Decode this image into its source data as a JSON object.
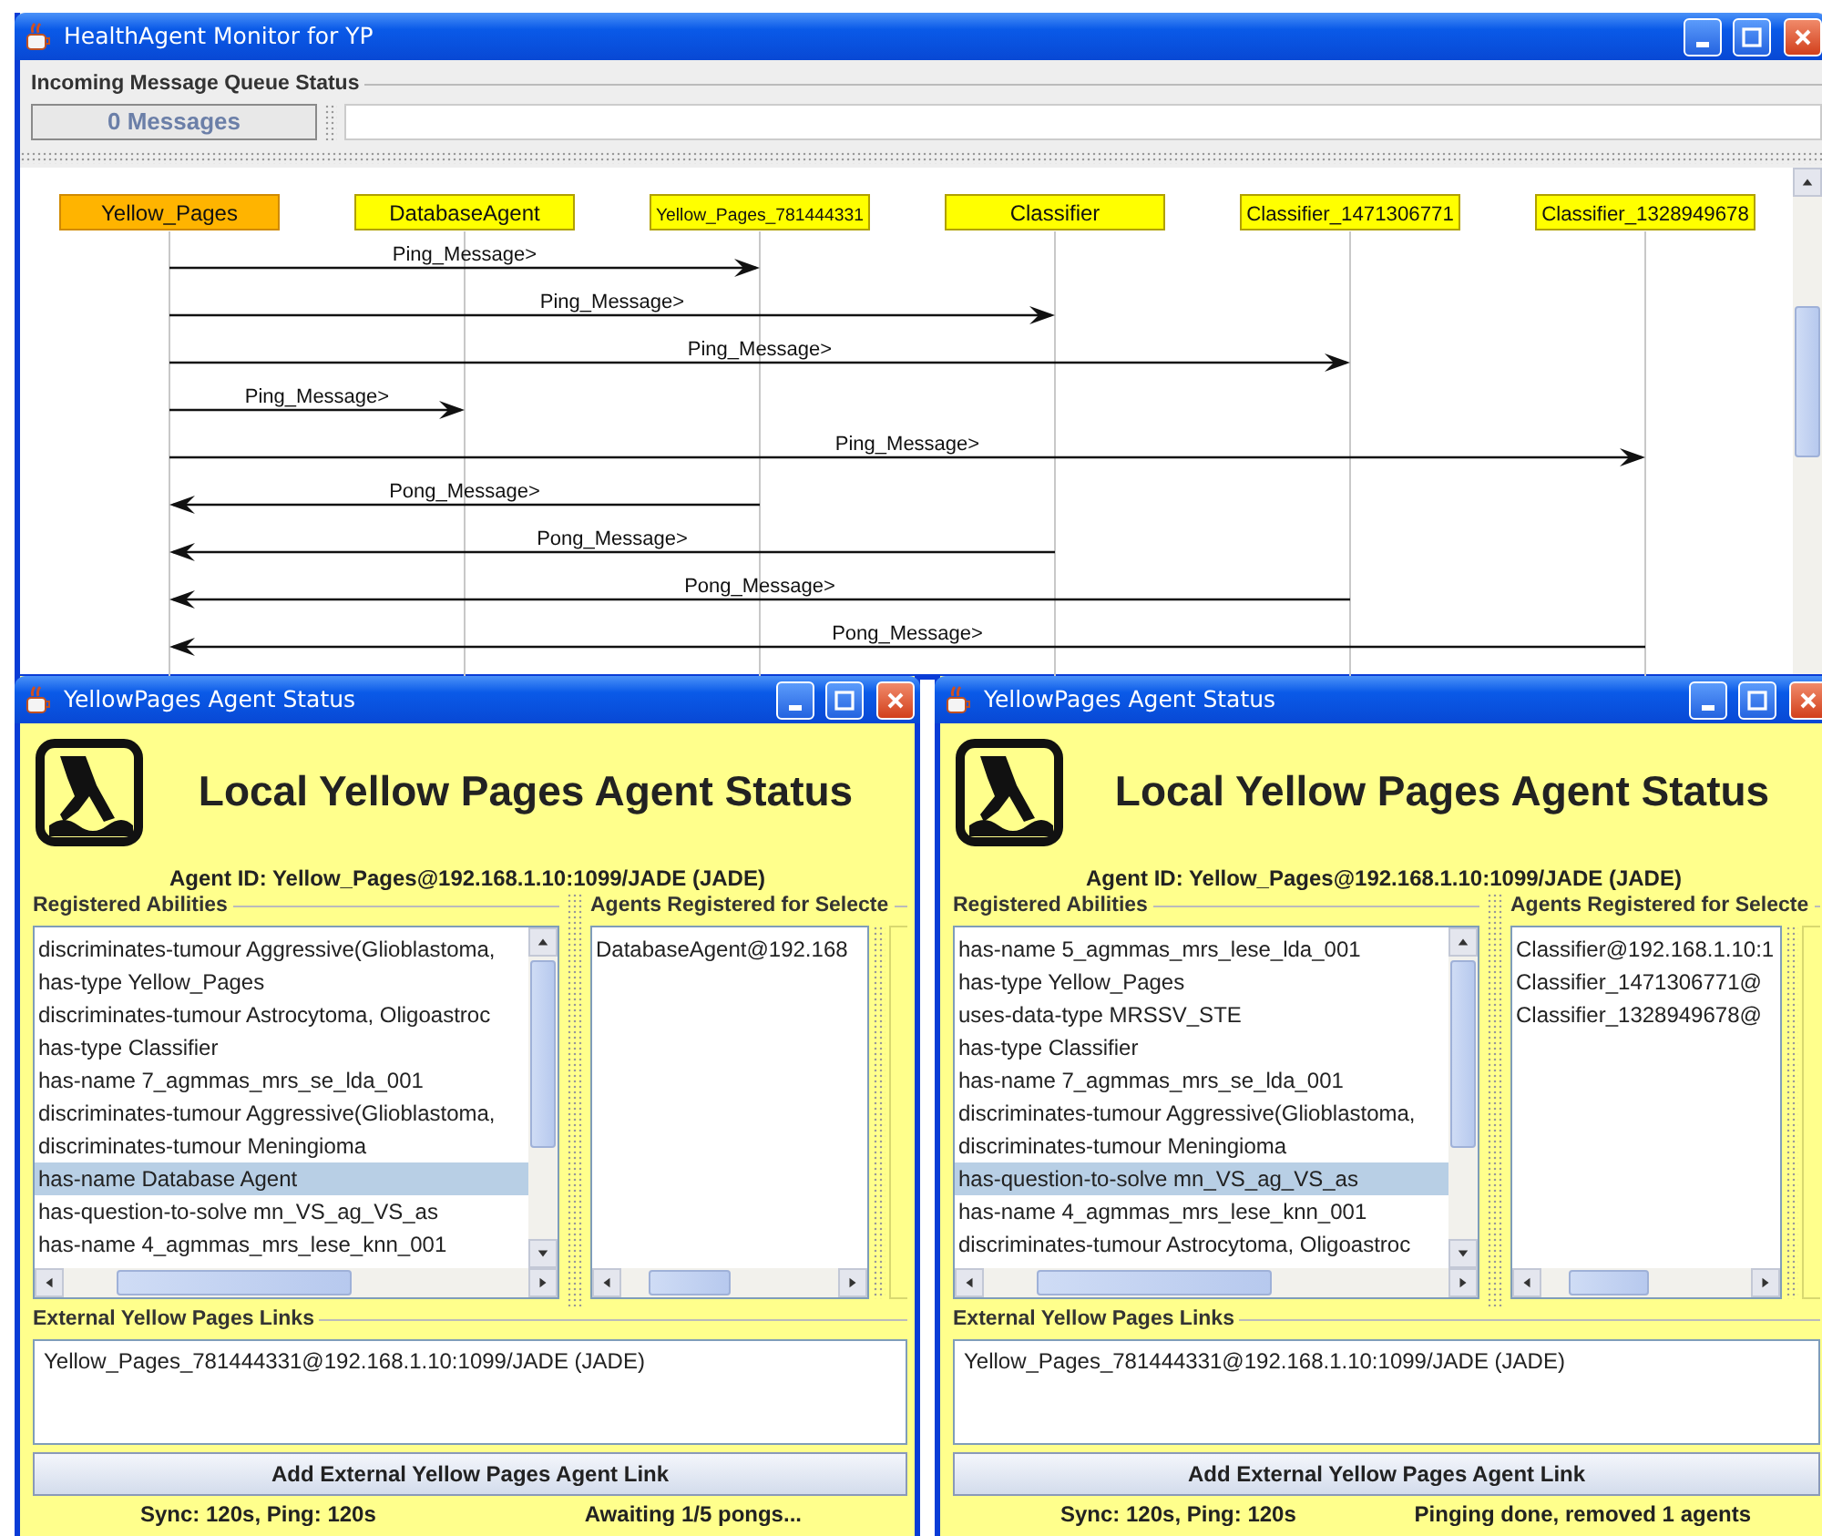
{
  "main_window": {
    "title": "HealthAgent Monitor for YP",
    "queue_group": "Incoming Message Queue Status",
    "message_count": "0 Messages",
    "sequence_diagram": {
      "agents": [
        {
          "name": "Yellow_Pages",
          "selected": true
        },
        {
          "name": "DatabaseAgent",
          "selected": false
        },
        {
          "name": "Yellow_Pages_781444331",
          "selected": false
        },
        {
          "name": "Classifier",
          "selected": false
        },
        {
          "name": "Classifier_1471306771",
          "selected": false
        },
        {
          "name": "Classifier_1328949678",
          "selected": false
        }
      ],
      "messages": [
        {
          "label": "Ping_Message>"
        },
        {
          "label": "Ping_Message>"
        },
        {
          "label": "Ping_Message>"
        },
        {
          "label": "Ping_Message>"
        },
        {
          "label": "Ping_Message>"
        },
        {
          "label": "Pong_Message>"
        },
        {
          "label": "Pong_Message>"
        },
        {
          "label": "Pong_Message>"
        },
        {
          "label": "Pong_Message>"
        }
      ]
    }
  },
  "status_windows": [
    {
      "title": "YellowPages Agent Status",
      "heading": "Local Yellow Pages Agent Status",
      "agent_id": "Agent ID: Yellow_Pages@192.168.1.10:1099/JADE (JADE)",
      "abilities_title": "Registered Abilities",
      "abilities": [
        {
          "text": "discriminates-tumour Aggressive(Glioblastoma,",
          "selected": false
        },
        {
          "text": "has-type Yellow_Pages",
          "selected": false
        },
        {
          "text": "discriminates-tumour Astrocytoma, Oligoastroc",
          "selected": false
        },
        {
          "text": "has-type Classifier",
          "selected": false
        },
        {
          "text": "has-name 7_agmmas_mrs_se_lda_001",
          "selected": false
        },
        {
          "text": "discriminates-tumour Aggressive(Glioblastoma,",
          "selected": false
        },
        {
          "text": "discriminates-tumour Meningioma",
          "selected": false
        },
        {
          "text": "has-name Database Agent",
          "selected": true
        },
        {
          "text": "has-question-to-solve mn_VS_ag_VS_as",
          "selected": false
        },
        {
          "text": "has-name 4_agmmas_mrs_lese_knn_001",
          "selected": false
        }
      ],
      "agents_title": "Agents Registered for Selecte",
      "agents": [
        {
          "text": "DatabaseAgent@192.168",
          "selected": false
        }
      ],
      "links_title": "External Yellow Pages Links",
      "links": [
        "Yellow_Pages_781444331@192.168.1.10:1099/JADE (JADE)"
      ],
      "add_button": "Add External Yellow Pages Agent Link",
      "sync_status": "Sync: 120s, Ping: 120s",
      "ping_status": "Awaiting 1/5 pongs..."
    },
    {
      "title": "YellowPages Agent Status",
      "heading": "Local Yellow Pages Agent Status",
      "agent_id": "Agent ID: Yellow_Pages@192.168.1.10:1099/JADE (JADE)",
      "abilities_title": "Registered Abilities",
      "abilities": [
        {
          "text": "has-name 5_agmmas_mrs_lese_lda_001",
          "selected": false
        },
        {
          "text": "has-type Yellow_Pages",
          "selected": false
        },
        {
          "text": "uses-data-type MRSSV_STE",
          "selected": false
        },
        {
          "text": "has-type Classifier",
          "selected": false
        },
        {
          "text": "has-name 7_agmmas_mrs_se_lda_001",
          "selected": false
        },
        {
          "text": "discriminates-tumour Aggressive(Glioblastoma,",
          "selected": false
        },
        {
          "text": "discriminates-tumour Meningioma",
          "selected": false
        },
        {
          "text": "has-question-to-solve mn_VS_ag_VS_as",
          "selected": true
        },
        {
          "text": "has-name 4_agmmas_mrs_lese_knn_001",
          "selected": false
        },
        {
          "text": "discriminates-tumour Astrocytoma, Oligoastroc",
          "selected": false
        }
      ],
      "agents_title": "Agents Registered for Selecte",
      "agents": [
        {
          "text": "Classifier@192.168.1.10:1",
          "selected": false
        },
        {
          "text": "Classifier_1471306771@",
          "selected": false
        },
        {
          "text": "Classifier_1328949678@",
          "selected": false
        }
      ],
      "links_title": "External Yellow Pages Links",
      "links": [
        "Yellow_Pages_781444331@192.168.1.10:1099/JADE (JADE)"
      ],
      "add_button": "Add External Yellow Pages Agent Link",
      "sync_status": "Sync: 120s, Ping: 120s",
      "ping_status": "Pinging done, removed 1 agents"
    }
  ]
}
